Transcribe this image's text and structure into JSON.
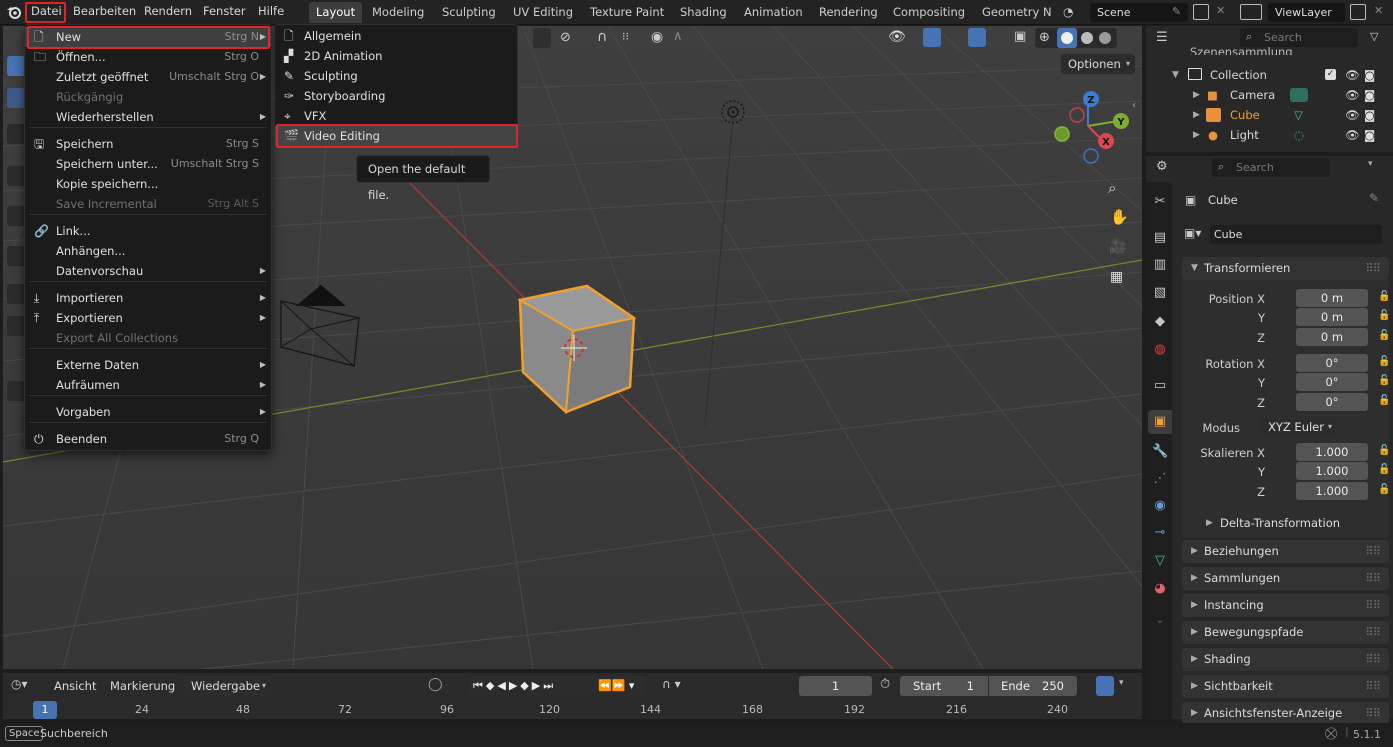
{
  "topbar": {
    "menus": [
      "Datei",
      "Bearbeiten",
      "Rendern",
      "Fenster",
      "Hilfe"
    ],
    "workspaces": [
      "Layout",
      "Modeling",
      "Sculpting",
      "UV Editing",
      "Texture Paint",
      "Shading",
      "Animation",
      "Rendering",
      "Compositing",
      "Geometry No"
    ],
    "active_workspace": "Layout",
    "scene": "Scene",
    "view_layer": "ViewLayer"
  },
  "file_menu": {
    "items": [
      {
        "label": "New",
        "shortcut": "Strg N",
        "submenu": true,
        "icon": "new-file-icon"
      },
      {
        "label": "Öffnen...",
        "shortcut": "Strg O",
        "icon": "folder-icon"
      },
      {
        "label": "Zuletzt geöffnet",
        "shortcut": "Umschalt Strg O",
        "submenu": true
      },
      {
        "label": "Rückgängig",
        "disabled": true
      },
      {
        "label": "Wiederherstellen",
        "submenu": true
      },
      {
        "label": "Speichern",
        "shortcut": "Strg S",
        "icon": "save-icon"
      },
      {
        "label": "Speichern unter...",
        "shortcut": "Umschalt Strg S"
      },
      {
        "label": "Kopie speichern..."
      },
      {
        "label": "Save Incremental",
        "shortcut": "Strg Alt S",
        "disabled": true
      },
      {
        "label": "Link...",
        "icon": "link-icon"
      },
      {
        "label": "Anhängen..."
      },
      {
        "label": "Datenvorschau",
        "submenu": true
      },
      {
        "label": "Importieren",
        "submenu": true,
        "icon": "import-icon"
      },
      {
        "label": "Exportieren",
        "submenu": true,
        "icon": "export-icon"
      },
      {
        "label": "Export All Collections",
        "disabled": true
      },
      {
        "label": "Externe Daten",
        "submenu": true
      },
      {
        "label": "Aufräumen",
        "submenu": true
      },
      {
        "label": "Vorgaben",
        "submenu": true
      },
      {
        "label": "Beenden",
        "shortcut": "Strg Q",
        "icon": "power-icon"
      }
    ]
  },
  "new_submenu": {
    "items": [
      "Allgemein",
      "2D Animation",
      "Sculpting",
      "Storyboarding",
      "VFX",
      "Video Editing"
    ],
    "highlighted": "Video Editing",
    "tooltip": "Open the default file."
  },
  "viewport": {
    "options_label": "Optionen",
    "gizmo_axes": [
      "Z",
      "Y",
      "X"
    ]
  },
  "outliner": {
    "search_placeholder": "Search",
    "root": "Szenensammlung",
    "collection": "Collection",
    "objects": [
      "Camera",
      "Cube",
      "Light"
    ]
  },
  "properties": {
    "search_placeholder": "Search",
    "object_name": "Cube",
    "data_name": "Cube",
    "transform_title": "Transformieren",
    "position_label": "Position X",
    "position": [
      "0 m",
      "0 m",
      "0 m"
    ],
    "rotation_label": "Rotation X",
    "rotation": [
      "0°",
      "0°",
      "0°"
    ],
    "mode_label": "Modus",
    "mode_value": "XYZ Euler",
    "scale_label": "Skalieren X",
    "scale": [
      "1.000",
      "1.000",
      "1.000"
    ],
    "axis_y": "Y",
    "axis_z": "Z",
    "delta": "Delta-Transformation",
    "panels": [
      "Beziehungen",
      "Sammlungen",
      "Instancing",
      "Bewegungspfade",
      "Shading",
      "Sichtbarkeit",
      "Ansichtsfenster-Anzeige"
    ]
  },
  "timeline": {
    "menus": [
      "Ansicht",
      "Markierung",
      "Wiedergabe"
    ],
    "current_frame": "1",
    "start_label": "Start",
    "start": "1",
    "end_label": "Ende",
    "end": "250",
    "ticks": [
      "1",
      "24",
      "48",
      "72",
      "96",
      "120",
      "144",
      "168",
      "192",
      "216",
      "240"
    ]
  },
  "statusbar": {
    "key": "Space",
    "action": "Suchbereich",
    "version": "5.1.1"
  },
  "colors": {
    "highlight_red": "#e0252a",
    "accent_blue": "#4772b3",
    "selection_orange": "#f0a030"
  }
}
